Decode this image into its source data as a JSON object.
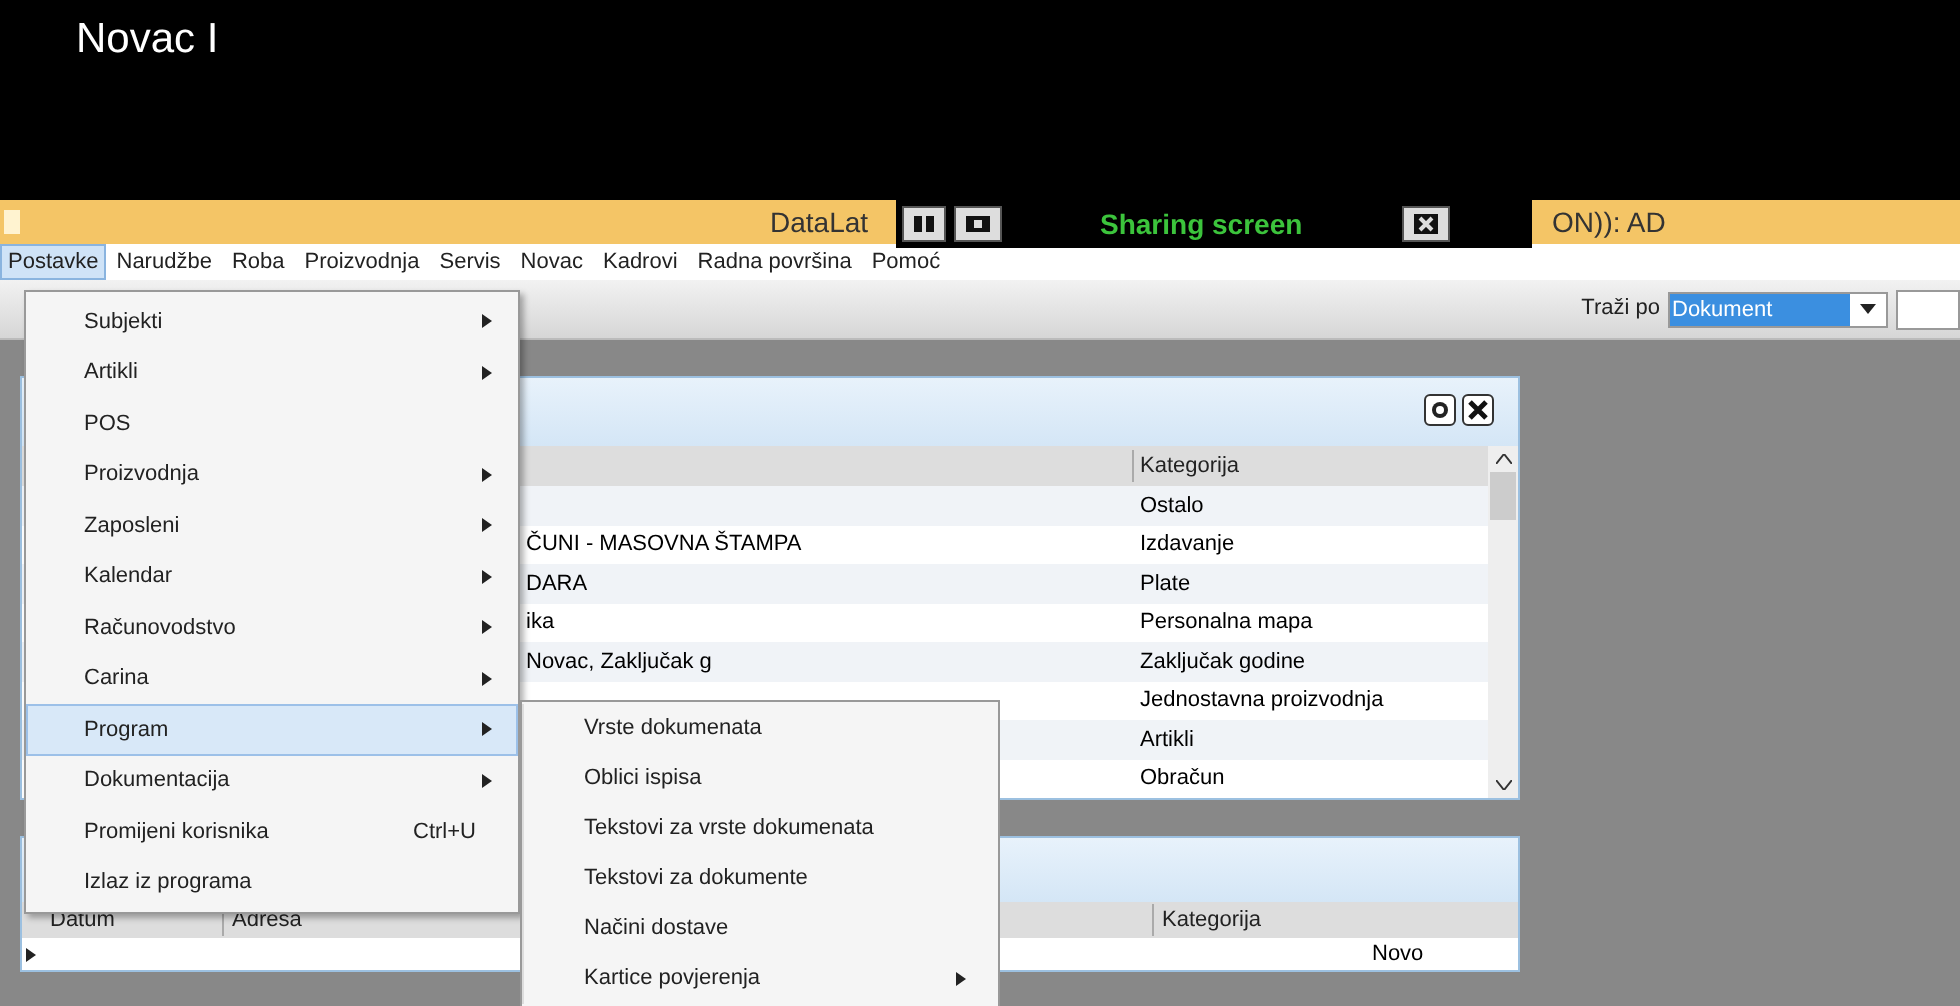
{
  "top_caption": "Novac I",
  "title_bar": {
    "title_left": "DataLat",
    "title_right": "ON)): AD"
  },
  "sharing_bar": {
    "status": "Sharing screen"
  },
  "menu_bar": [
    {
      "label": "Postavke",
      "selected": true
    },
    {
      "label": "Narudžbe",
      "selected": false
    },
    {
      "label": "Roba",
      "selected": false
    },
    {
      "label": "Proizvodnja",
      "selected": false
    },
    {
      "label": "Servis",
      "selected": false
    },
    {
      "label": "Novac",
      "selected": false
    },
    {
      "label": "Kadrovi",
      "selected": false
    },
    {
      "label": "Radna površina",
      "selected": false
    },
    {
      "label": "Pomoć",
      "selected": false
    }
  ],
  "search": {
    "label": "Traži po",
    "value": "Dokument"
  },
  "panel_1": {
    "columns": [
      "Kategorija"
    ],
    "rows": [
      {
        "kategorija": "Ostalo"
      },
      {
        "column_1": "ČUNI - MASOVNA ŠTAMPA",
        "kategorija": "Izdavanje"
      },
      {
        "column_1": "DARA",
        "kategorija": "Plate"
      },
      {
        "column_1": "ika",
        "kategorija": "Personalna mapa"
      },
      {
        "column_1": "Novac, Zaključak g",
        "kategorija": "Zaključak godine"
      },
      {
        "kategorija": "Jednostavna proizvodnja"
      },
      {
        "kategorija": "Artikli"
      },
      {
        "kategorija": "Obračun"
      }
    ]
  },
  "panel_2": {
    "columns": [
      "Datum",
      "Adresa",
      "Kategorija"
    ],
    "rows": [
      {
        "kategorija": "Novo"
      }
    ]
  },
  "open_menu": {
    "items": [
      {
        "label": "Subjekti",
        "submenu": true,
        "selected": false
      },
      {
        "label": "Artikli",
        "submenu": true,
        "selected": false
      },
      {
        "label": "POS",
        "submenu": false,
        "selected": false
      },
      {
        "label": "Proizvodnja",
        "submenu": true,
        "selected": false
      },
      {
        "label": "Zaposleni",
        "submenu": true,
        "selected": false
      },
      {
        "label": "Kalendar",
        "submenu": true,
        "selected": false
      },
      {
        "label": "Računovodstvo",
        "submenu": true,
        "selected": false
      },
      {
        "label": "Carina",
        "submenu": true,
        "selected": false
      },
      {
        "label": "Program",
        "submenu": true,
        "selected": true
      },
      {
        "label": "Dokumentacija",
        "submenu": true,
        "selected": false
      },
      {
        "label": "Promijeni korisnika",
        "shortcut": "Ctrl+U",
        "submenu": false,
        "selected": false
      },
      {
        "label": "Izlaz iz programa",
        "submenu": false,
        "selected": false
      }
    ]
  },
  "submenu": {
    "items": [
      {
        "label": "Vrste dokumenata",
        "submenu": false
      },
      {
        "label": "Oblici ispisa",
        "submenu": false
      },
      {
        "label": "Tekstovi za vrste dokumenata",
        "submenu": false
      },
      {
        "label": "Tekstovi za dokumente",
        "submenu": false
      },
      {
        "label": "Načini dostave",
        "submenu": false
      },
      {
        "label": "Kartice povjerenja",
        "submenu": true
      }
    ]
  }
}
